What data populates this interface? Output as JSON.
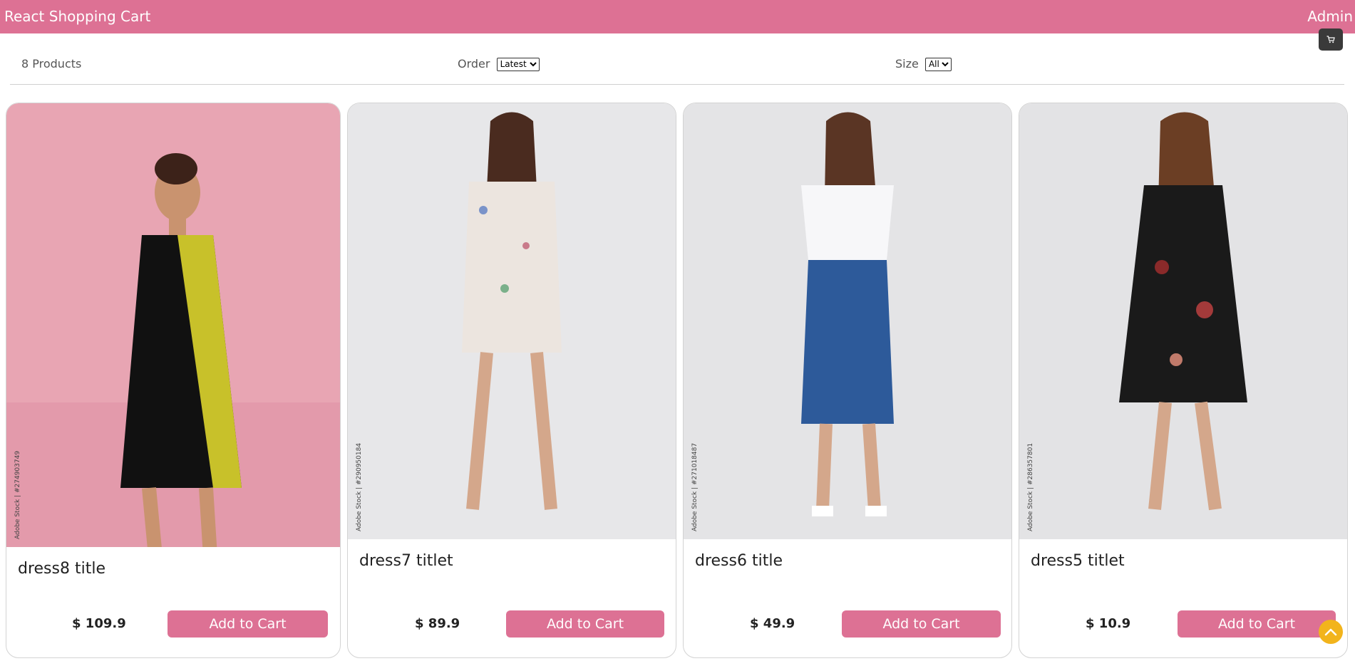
{
  "header": {
    "brand": "React Shopping Cart",
    "admin_label": "Admin",
    "cart_icon": "cart-icon"
  },
  "filter": {
    "count_label": "8 Products",
    "order_label": "Order",
    "order_selected": "Latest",
    "size_label": "Size",
    "size_selected": "All"
  },
  "products": [
    {
      "title": "dress8 title",
      "price": "$ 109.9",
      "button_label": "Add to Cart",
      "stock_text": "Adobe Stock | #274903749"
    },
    {
      "title": "dress7 titlet",
      "price": "$ 89.9",
      "button_label": "Add to Cart",
      "stock_text": "Adobe Stock | #290950184"
    },
    {
      "title": "dress6 title",
      "price": "$ 49.9",
      "button_label": "Add to Cart",
      "stock_text": "Adobe Stock | #271018487"
    },
    {
      "title": "dress5 titlet",
      "price": "$ 10.9",
      "button_label": "Add to Cart",
      "stock_text": "Adobe Stock | #286357801"
    }
  ],
  "colors": {
    "accent": "#dd7194",
    "scroll_top": "#f2b41c"
  }
}
